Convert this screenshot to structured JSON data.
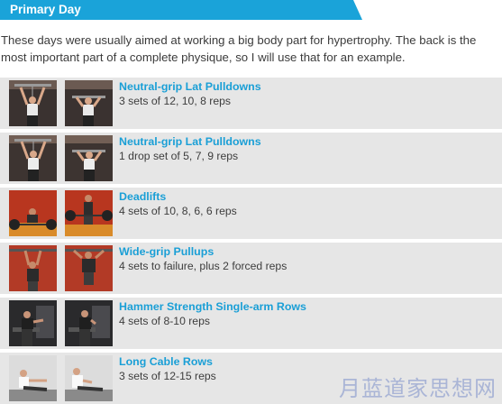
{
  "header": {
    "title": "Primary Day",
    "accent_color": "#1aa3d9"
  },
  "intro": "These days were usually aimed at working a big body part for hypertrophy. The back is the most important part of a complete physique, so I will use that for an example.",
  "exercises": [
    {
      "name": "Neutral-grip Lat Pulldowns",
      "sets": "3 sets of 12, 10, 8 reps",
      "thumb_theme": "gym-dark"
    },
    {
      "name": "Neutral-grip Lat Pulldowns",
      "sets": "1 drop set of 5, 7, 9 reps",
      "thumb_theme": "gym-dark"
    },
    {
      "name": "Deadlifts",
      "sets": "4 sets of 10, 8, 6, 6 reps",
      "thumb_theme": "gym-red"
    },
    {
      "name": "Wide-grip Pullups",
      "sets": "4 sets to failure, plus 2 forced reps",
      "thumb_theme": "gym-red"
    },
    {
      "name": "Hammer Strength Single-arm Rows",
      "sets": "4 sets of 8-10 reps",
      "thumb_theme": "gym-dark"
    },
    {
      "name": "Long Cable Rows",
      "sets": "3 sets of 12-15 reps",
      "thumb_theme": "gym-light"
    }
  ],
  "watermark": "月蓝道家思想网",
  "colors": {
    "exercise_name": "#1a9fd6",
    "row_background": "#e6e6e6",
    "body_text": "#3b3b3b"
  }
}
